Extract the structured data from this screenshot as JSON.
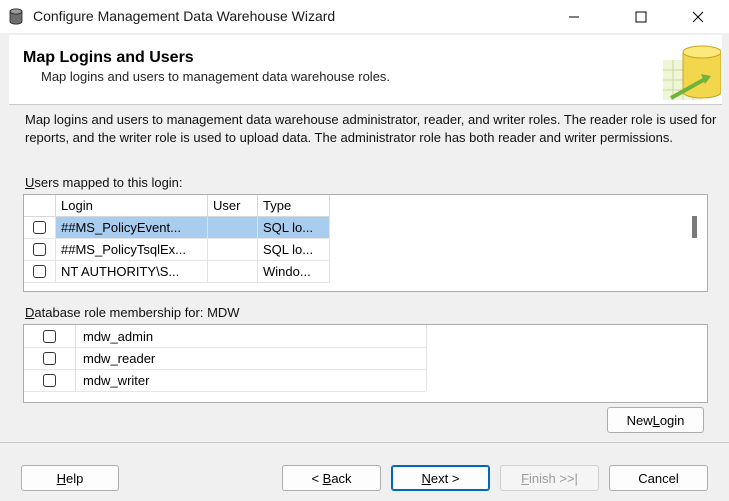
{
  "window": {
    "title": "Configure Management Data Warehouse Wizard",
    "controls": [
      "minimize-icon",
      "maximize-icon",
      "close-icon"
    ]
  },
  "header": {
    "title": "Map Logins and Users",
    "subtitle": "Map logins and users to management data warehouse roles."
  },
  "description": "Map logins and users to management data warehouse administrator, reader, and writer roles. The reader role is used for reports, and the writer role is used to upload data. The administrator role has both reader and writer permissions.",
  "users_grid": {
    "label_accel": "U",
    "label_rest": "sers mapped to this login:",
    "columns": [
      "Login",
      "User",
      "Type"
    ],
    "rows": [
      {
        "checked": false,
        "login": "##MS_PolicyEvent...",
        "user": "",
        "type": "SQL lo...",
        "selected": true
      },
      {
        "checked": false,
        "login": "##MS_PolicyTsqlEx...",
        "user": "",
        "type": "SQL lo...",
        "selected": false
      },
      {
        "checked": false,
        "login": "NT AUTHORITY\\S...",
        "user": "",
        "type": "Windo...",
        "selected": false
      }
    ]
  },
  "roles": {
    "label_accel": "D",
    "label_rest": "atabase role membership for: MDW",
    "items": [
      {
        "checked": false,
        "name": "mdw_admin"
      },
      {
        "checked": false,
        "name": "mdw_reader"
      },
      {
        "checked": false,
        "name": "mdw_writer"
      }
    ]
  },
  "buttons": {
    "new_login_pre": "New ",
    "new_login_accel": "L",
    "new_login_post": "ogin",
    "help_accel": "H",
    "help_rest": "elp",
    "back_pre": "< ",
    "back_accel": "B",
    "back_post": "ack",
    "next_accel": "N",
    "next_post": "ext >",
    "finish_accel": "F",
    "finish_post": "inish >>|",
    "cancel": "Cancel"
  },
  "colors": {
    "selection": "#a9cdef",
    "default_button_border": "#0067c0"
  }
}
